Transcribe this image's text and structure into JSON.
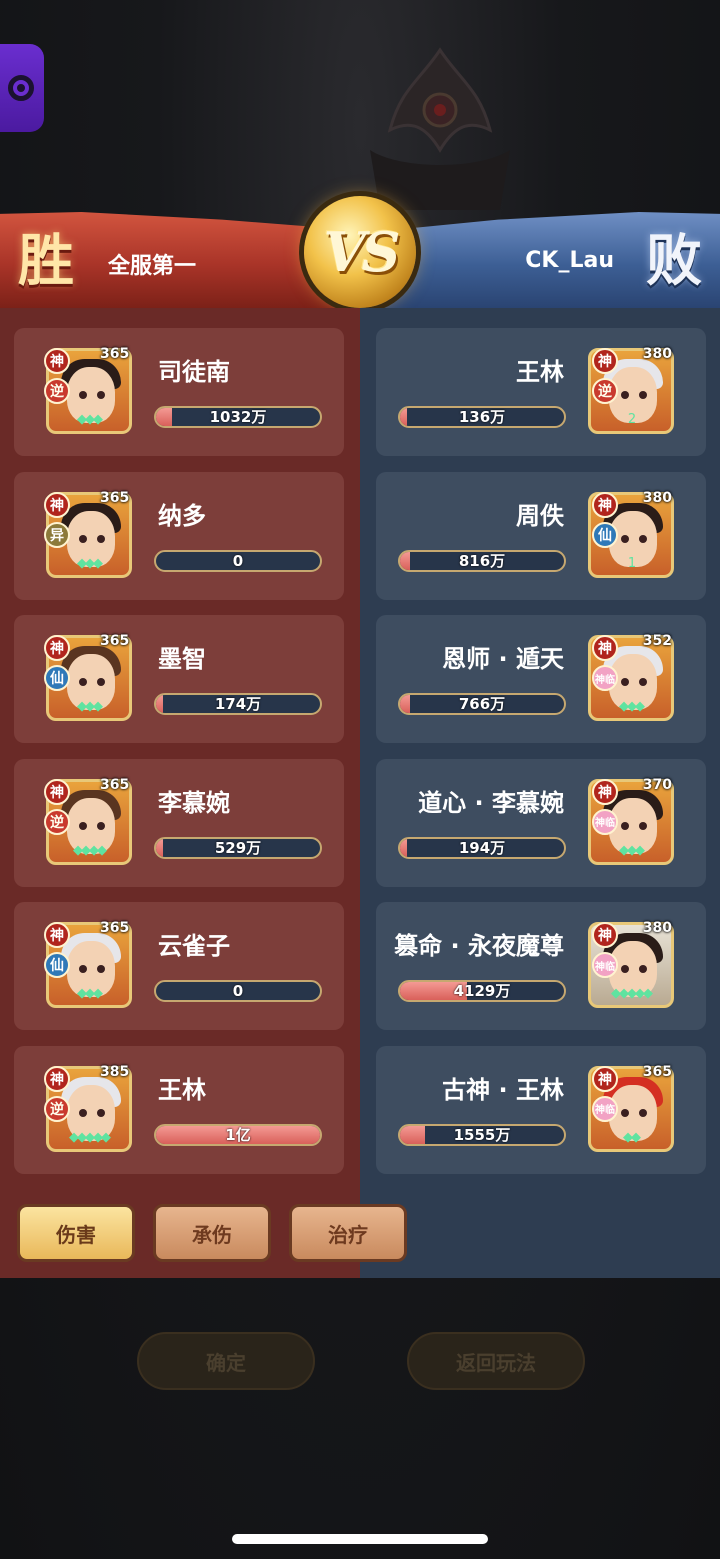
{
  "header": {
    "result_left": "胜",
    "result_right": "败",
    "player_left": "全服第一",
    "player_right": "CK_Lau",
    "vs_label": "VS"
  },
  "left_team": [
    {
      "name": "司徒南",
      "level": "365",
      "tags": [
        "神",
        "逆"
      ],
      "value": "1032万",
      "fill": 0.1,
      "skin": "dark",
      "gems": "◆◆◆"
    },
    {
      "name": "纳多",
      "level": "365",
      "tags": [
        "神",
        "异"
      ],
      "value": "0",
      "fill": 0,
      "skin": "dark",
      "gems": "◆◆◆"
    },
    {
      "name": "墨智",
      "level": "365",
      "tags": [
        "神",
        "仙"
      ],
      "value": "174万",
      "fill": 0,
      "skin": "brown",
      "gems": "◆◆◆"
    },
    {
      "name": "李慕婉",
      "level": "365",
      "tags": [
        "神",
        "逆"
      ],
      "value": "529万",
      "fill": 0.04,
      "skin": "brown",
      "gems": "◆◆◆◆"
    },
    {
      "name": "云雀子",
      "level": "365",
      "tags": [
        "神",
        "仙"
      ],
      "value": "0",
      "fill": 0,
      "skin": "silver",
      "gems": "◆◆◆"
    },
    {
      "name": "王林",
      "level": "385",
      "tags": [
        "神",
        "逆"
      ],
      "value": "1亿",
      "fill": 1.0,
      "skin": "silver",
      "gems": "◆◆◆◆◆"
    }
  ],
  "right_team": [
    {
      "name": "王林",
      "level": "380",
      "tags": [
        "神",
        "逆"
      ],
      "value": "136万",
      "fill": 0,
      "skin": "silver",
      "gems": "2"
    },
    {
      "name": "周佚",
      "level": "380",
      "tags": [
        "神",
        "仙"
      ],
      "value": "816万",
      "fill": 0.06,
      "skin": "dark",
      "gems": "1"
    },
    {
      "name": "恩师 · 遁天",
      "level": "352",
      "tags": [
        "神",
        "神临"
      ],
      "value": "766万",
      "fill": 0.06,
      "skin": "silver",
      "gems": "◆◆◆"
    },
    {
      "name": "道心 · 李慕婉",
      "level": "370",
      "tags": [
        "神",
        "神临"
      ],
      "value": "194万",
      "fill": 0,
      "skin": "dark",
      "gems": "◆◆◆"
    },
    {
      "name": "篡命 · 永夜魔尊",
      "level": "380",
      "tags": [
        "神",
        "神临"
      ],
      "value": "4129万",
      "fill": 0.41,
      "skin": "pale",
      "gems": "◆◆◆◆◆"
    },
    {
      "name": "古神 · 王林",
      "level": "365",
      "tags": [
        "神",
        "神临"
      ],
      "value": "1555万",
      "fill": 0.15,
      "skin": "red",
      "gems": "◆◆"
    }
  ],
  "tabs": [
    {
      "label": "伤害",
      "active": true
    },
    {
      "label": "承伤",
      "active": false
    },
    {
      "label": "治疗",
      "active": false
    }
  ],
  "buttons": {
    "confirm": "确定",
    "back": "返回玩法"
  },
  "colors": {
    "winner_panel": "#6a2a27",
    "loser_panel": "#2e3d51",
    "bar_fill": "#d9605a"
  }
}
